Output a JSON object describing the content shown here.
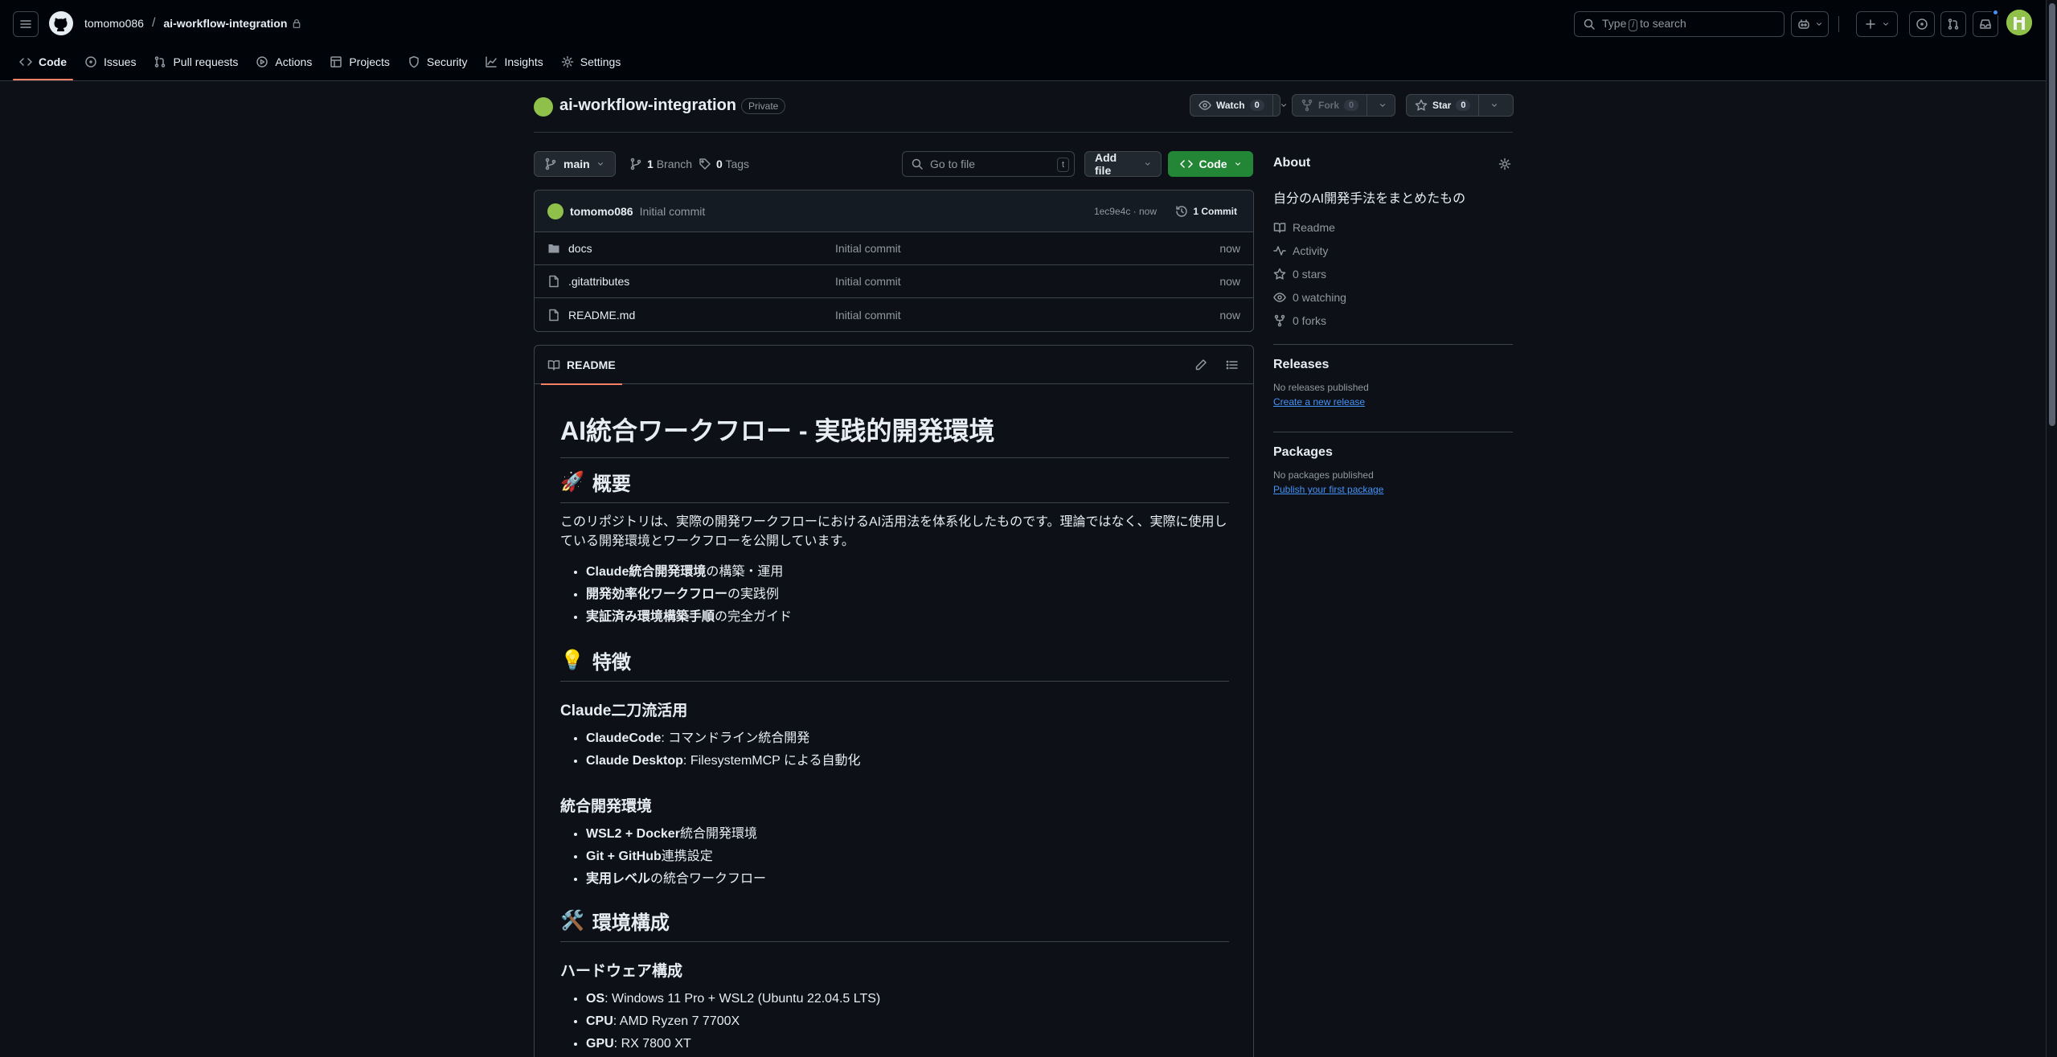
{
  "header": {
    "owner": "tomomo086",
    "separator": "/",
    "repo": "ai-workflow-integration",
    "search": {
      "prefix": "Type",
      "key": "/",
      "suffix": "to search"
    }
  },
  "nav": [
    {
      "label": "Code",
      "icon": "code-icon",
      "active": true
    },
    {
      "label": "Issues",
      "icon": "issue-icon"
    },
    {
      "label": "Pull requests",
      "icon": "pull-request-icon"
    },
    {
      "label": "Actions",
      "icon": "play-icon"
    },
    {
      "label": "Projects",
      "icon": "table-icon"
    },
    {
      "label": "Security",
      "icon": "shield-icon"
    },
    {
      "label": "Insights",
      "icon": "graph-icon"
    },
    {
      "label": "Settings",
      "icon": "gear-icon"
    }
  ],
  "repo_head": {
    "name": "ai-workflow-integration",
    "visibility": "Private",
    "watch_label": "Watch",
    "watch_count": "0",
    "fork_label": "Fork",
    "fork_count": "0",
    "star_label": "Star",
    "star_count": "0"
  },
  "toolbar": {
    "branch": "main",
    "branch_count": "1",
    "branch_label": "Branch",
    "tag_count": "0",
    "tag_label": "Tags",
    "goto_placeholder": "Go to file",
    "goto_key": "t",
    "add_file": "Add file",
    "code": "Code"
  },
  "latest_commit": {
    "user": "tomomo086",
    "message": "Initial commit",
    "meta": "1ec9e4c · now",
    "commits": "1 Commit"
  },
  "files": [
    {
      "name": "docs",
      "type": "folder",
      "message": "Initial commit",
      "age": "now"
    },
    {
      "name": ".gitattributes",
      "type": "file",
      "message": "Initial commit",
      "age": "now"
    },
    {
      "name": "README.md",
      "type": "file",
      "message": "Initial commit",
      "age": "now"
    }
  ],
  "readme": {
    "tab": "README",
    "h1": "AI統合ワークフロー - 実践的開発環境",
    "s1_emoji": "🚀",
    "s1_title": "概要",
    "intro_line1": "このリポジトリは、実際の開発ワークフローにおけるAI活用法を体系化したものです。理論ではなく、実際に使用し",
    "intro_line2": "ている開発環境とワークフローを公開しています。",
    "overview": [
      {
        "b": "Claude統合開発環境",
        "t": "の構築・運用"
      },
      {
        "b": "開発効率化ワークフロー",
        "t": "の実践例"
      },
      {
        "b": "実証済み環境構築手順",
        "t": "の完全ガイド"
      }
    ],
    "s2_emoji": "💡",
    "s2_title": "特徴",
    "h3_claude": "Claude二刀流活用",
    "claude_items": [
      {
        "b": "ClaudeCode",
        "t": ": コマンドライン統合開発"
      },
      {
        "b": "Claude Desktop",
        "t": ": FilesystemMCP による自動化"
      }
    ],
    "h3_env": "統合開発環境",
    "env_items": [
      {
        "b": "WSL2 + Docker",
        "t": "統合開発環境"
      },
      {
        "b": "Git + GitHub",
        "t": "連携設定"
      },
      {
        "b": "実用レベル",
        "t": "の統合ワークフロー"
      }
    ],
    "s3_emoji": "🛠️",
    "s3_title": "環境構成",
    "h3_hw": "ハードウェア構成",
    "hw_items": [
      {
        "b": "OS",
        "t": ": Windows 11 Pro + WSL2 (Ubuntu 22.04.5 LTS)"
      },
      {
        "b": "CPU",
        "t": ": AMD Ryzen 7 7700X"
      },
      {
        "b": "GPU",
        "t": ": RX 7800 XT"
      }
    ]
  },
  "about": {
    "title": "About",
    "description": "自分のAI開発手法をまとめたもの",
    "links": [
      {
        "label": "Readme",
        "icon": "book-icon"
      },
      {
        "label": "Activity",
        "icon": "pulse-icon"
      },
      {
        "label": "0 stars",
        "icon": "star-icon"
      },
      {
        "label": "0 watching",
        "icon": "eye-icon"
      },
      {
        "label": "0 forks",
        "icon": "fork-icon"
      }
    ]
  },
  "releases": {
    "title": "Releases",
    "empty": "No releases published",
    "link": "Create a new release"
  },
  "packages": {
    "title": "Packages",
    "empty": "No packages published",
    "link": "Publish your first package"
  },
  "colors": {
    "bg": "#0d1117",
    "header_bg": "#010409",
    "accent_green": "#238636",
    "link_blue": "#4493f8",
    "tab_underline": "#f78166"
  }
}
